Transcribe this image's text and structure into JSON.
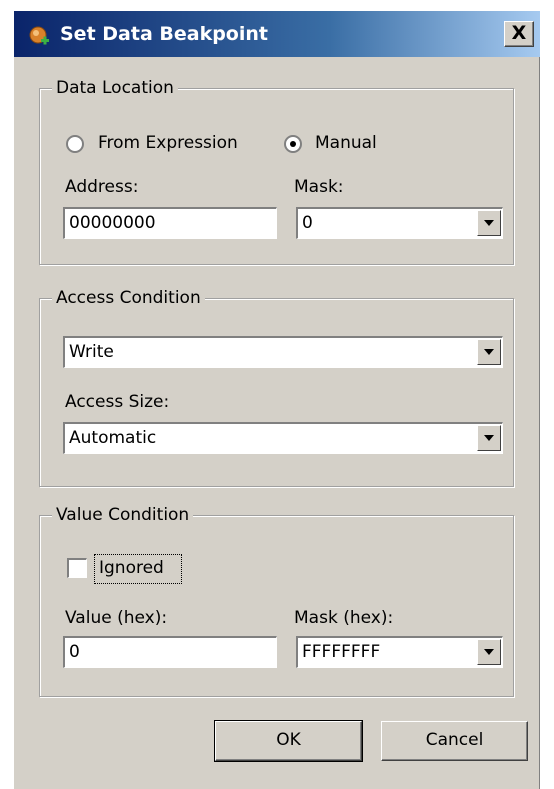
{
  "dialog": {
    "title": "Set Data Beakpoint",
    "close_symbol": "X"
  },
  "data_location": {
    "legend": "Data Location",
    "radio_from_expression": "From Expression",
    "radio_manual": "Manual",
    "selected": "Manual",
    "address_label": "Address:",
    "address_value": "00000000",
    "mask_label": "Mask:",
    "mask_value": "0"
  },
  "access_condition": {
    "legend": "Access Condition",
    "condition_value": "Write",
    "size_label": "Access Size:",
    "size_value": "Automatic"
  },
  "value_condition": {
    "legend": "Value Condition",
    "ignored_label": "Ignored",
    "ignored_checked": false,
    "value_label": "Value (hex):",
    "value_value": "0",
    "mask_label": "Mask (hex):",
    "mask_value": "FFFFFFFF"
  },
  "buttons": {
    "ok": "OK",
    "cancel": "Cancel"
  },
  "icons": {
    "title": "breakpoint-icon",
    "dropdown": "chevron-down-icon"
  }
}
